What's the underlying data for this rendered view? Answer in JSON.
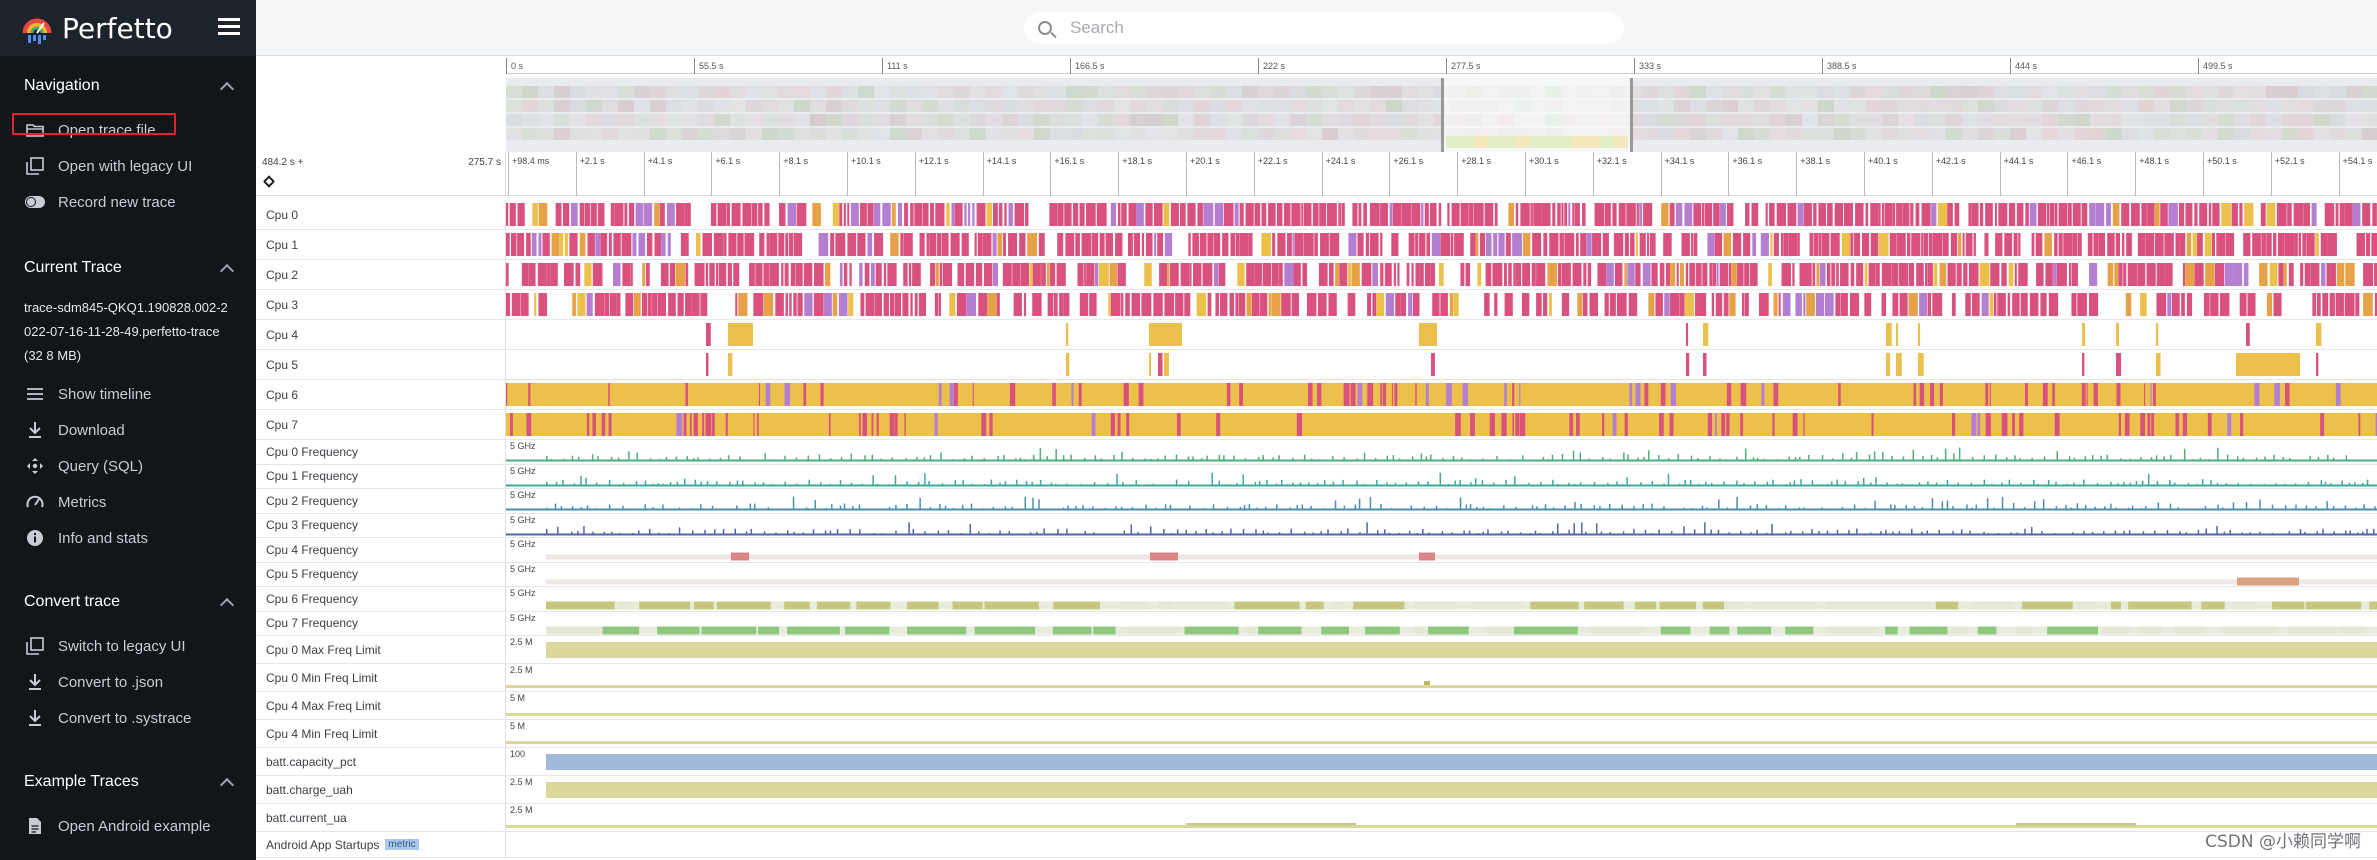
{
  "app": {
    "title": "Perfetto",
    "search_placeholder": "Search"
  },
  "sidebar": {
    "sections": [
      {
        "title": "Navigation",
        "items": [
          {
            "label": "Open trace file",
            "icon": "folder-open-icon"
          },
          {
            "label": "Open with legacy UI",
            "icon": "filter-none-icon"
          },
          {
            "label": "Record new trace",
            "icon": "toggle-record-icon"
          }
        ]
      },
      {
        "title": "Current Trace",
        "trace_name": "trace-sdm845-QKQ1.190828.002-2022-07-16-11-28-49.perfetto-trace (32 8 MB)",
        "items": [
          {
            "label": "Show timeline",
            "icon": "list-lines-icon"
          },
          {
            "label": "Download",
            "icon": "download-icon"
          },
          {
            "label": "Query (SQL)",
            "icon": "move-cross-icon"
          },
          {
            "label": "Metrics",
            "icon": "speed-gauge-icon"
          },
          {
            "label": "Info and stats",
            "icon": "info-icon"
          }
        ]
      },
      {
        "title": "Convert trace",
        "items": [
          {
            "label": "Switch to legacy UI",
            "icon": "filter-none-icon"
          },
          {
            "label": "Convert to .json",
            "icon": "download-icon"
          },
          {
            "label": "Convert to .systrace",
            "icon": "download-icon"
          }
        ]
      },
      {
        "title": "Example Traces",
        "items": [
          {
            "label": "Open Android example",
            "icon": "description-icon"
          }
        ]
      }
    ]
  },
  "overview": {
    "ticks": [
      "0 s",
      "55.5 s",
      "111 s",
      "166.5 s",
      "222 s",
      "277.5 s",
      "333 s",
      "388.5 s",
      "444 s",
      "499.5 s"
    ]
  },
  "ruler": {
    "left_start": "484.2 s +",
    "left_end": "275.7 s",
    "ticks": [
      "+98.4 ms",
      "+2.1 s",
      "+4.1 s",
      "+6.1 s",
      "+8.1 s",
      "+10.1 s",
      "+12.1 s",
      "+14.1 s",
      "+16.1 s",
      "+18.1 s",
      "+20.1 s",
      "+22.1 s",
      "+24.1 s",
      "+26.1 s",
      "+28.1 s",
      "+30.1 s",
      "+32.1 s",
      "+34.1 s",
      "+36.1 s",
      "+38.1 s",
      "+40.1 s",
      "+42.1 s",
      "+44.1 s",
      "+46.1 s",
      "+48.1 s",
      "+50.1 s",
      "+52.1 s",
      "+54.1 s"
    ]
  },
  "tracks": [
    {
      "name": "Cpu 0",
      "kind": "cpu",
      "density": 0.9,
      "yellow": 0.06
    },
    {
      "name": "Cpu 1",
      "kind": "cpu",
      "density": 0.92,
      "yellow": 0.12
    },
    {
      "name": "Cpu 2",
      "kind": "cpu",
      "density": 0.85,
      "yellow": 0.15
    },
    {
      "name": "Cpu 3",
      "kind": "cpu",
      "density": 0.75,
      "yellow": 0.15
    },
    {
      "name": "Cpu 4",
      "kind": "cpu_sparse",
      "density": 0.02,
      "yellow": 0.7
    },
    {
      "name": "Cpu 5",
      "kind": "cpu_sparse",
      "density": 0.02,
      "yellow": 0.5
    },
    {
      "name": "Cpu 6",
      "kind": "cpu_big",
      "density": 1.0,
      "yellow": 0.7
    },
    {
      "name": "Cpu 7",
      "kind": "cpu_big",
      "density": 1.0,
      "yellow": 0.6
    },
    {
      "name": "Cpu 0 Frequency",
      "kind": "freq",
      "scale": "5 GHz",
      "color": "#4caf7a"
    },
    {
      "name": "Cpu 1 Frequency",
      "kind": "freq",
      "scale": "5 GHz",
      "color": "#3ea99a"
    },
    {
      "name": "Cpu 2 Frequency",
      "kind": "freq",
      "scale": "5 GHz",
      "color": "#4a8fb0"
    },
    {
      "name": "Cpu 3 Frequency",
      "kind": "freq",
      "scale": "5 GHz",
      "color": "#5563b0"
    },
    {
      "name": "Cpu 4 Frequency",
      "kind": "freq_big",
      "scale": "5 GHz",
      "color": "#d08a8a"
    },
    {
      "name": "Cpu 5 Frequency",
      "kind": "freq_big",
      "scale": "5 GHz",
      "color": "#e08a6a"
    },
    {
      "name": "Cpu 6 Frequency",
      "kind": "freq_band",
      "scale": "5 GHz",
      "color": "#c7c77f"
    },
    {
      "name": "Cpu 7 Frequency",
      "kind": "freq_band",
      "scale": "5 GHz",
      "color": "#8fc77f"
    },
    {
      "name": "Cpu 0 Max Freq Limit",
      "kind": "counter_fill",
      "scale": "2.5 M",
      "color": "#d9d79a"
    },
    {
      "name": "Cpu 0 Min Freq Limit",
      "kind": "counter_line",
      "scale": "2.5 M",
      "color": "#d9d79a"
    },
    {
      "name": "Cpu 4 Max Freq Limit",
      "kind": "counter_line",
      "scale": "5 M",
      "color": "#d9d79a"
    },
    {
      "name": "Cpu 4 Min Freq Limit",
      "kind": "counter_line",
      "scale": "5 M",
      "color": "#d9d79a"
    },
    {
      "name": "batt.capacity_pct",
      "kind": "counter_fill",
      "scale": "100",
      "color": "#9fb9d8"
    },
    {
      "name": "batt.charge_uah",
      "kind": "counter_fill",
      "scale": "2.5 M",
      "color": "#d9d79a"
    },
    {
      "name": "batt.current_ua",
      "kind": "counter_line",
      "scale": "2.5 M",
      "color": "#d9d79a"
    },
    {
      "name": "Android App Startups",
      "kind": "empty",
      "badge": "metric"
    }
  ],
  "watermark": "CSDN @小赖同学啊"
}
